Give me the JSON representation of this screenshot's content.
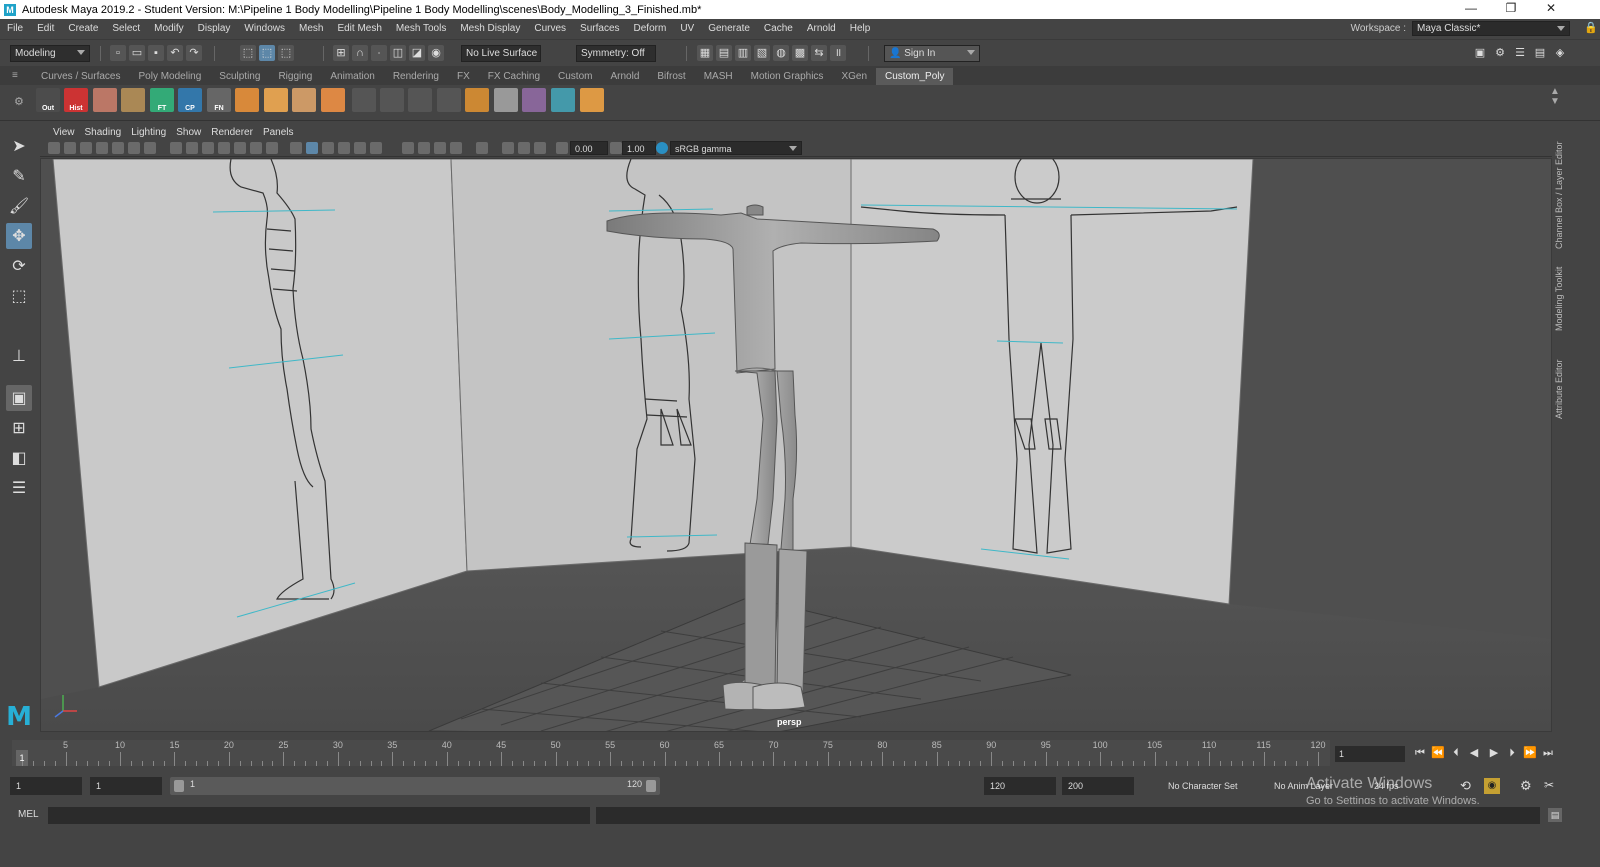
{
  "window": {
    "title": "Autodesk Maya 2019.2 - Student Version: M:\\Pipeline 1 Body Modelling\\Pipeline 1 Body Modelling\\scenes\\Body_Modelling_3_Finished.mb*",
    "app_icon_letter": "M",
    "minimize_glyph": "—",
    "restore_glyph": "❐",
    "close_glyph": "✕"
  },
  "menubar": {
    "items": [
      "File",
      "Edit",
      "Create",
      "Select",
      "Modify",
      "Display",
      "Windows",
      "Mesh",
      "Edit Mesh",
      "Mesh Tools",
      "Mesh Display",
      "Curves",
      "Surfaces",
      "Deform",
      "UV",
      "Generate",
      "Cache",
      "Arnold",
      "Help"
    ],
    "workspace_label": "Workspace :",
    "workspace_value": "Maya Classic*",
    "lock_glyph": "🔒"
  },
  "statusline": {
    "menuset": "Modeling",
    "live_surface": "No Live Surface",
    "symmetry": "Symmetry: Off",
    "sign_in": "Sign In"
  },
  "shelf": {
    "tabs": [
      "Curves / Surfaces",
      "Poly Modeling",
      "Sculpting",
      "Rigging",
      "Animation",
      "Rendering",
      "FX",
      "FX Caching",
      "Custom",
      "Arnold",
      "Bifrost",
      "MASH",
      "Motion Graphics",
      "XGen",
      "Custom_Poly"
    ],
    "active_tab": "Custom_Poly",
    "icon_labels": [
      "Out",
      "Hist",
      "FT",
      "CP",
      "FN"
    ]
  },
  "panel": {
    "menus": [
      "View",
      "Shading",
      "Lighting",
      "Show",
      "Renderer",
      "Panels"
    ],
    "exposure": "0.00",
    "gamma": "1.00",
    "color_space": "sRGB gamma",
    "camera_label": "persp"
  },
  "right_tabs": [
    "Channel Box / Layer Editor",
    "Modeling Toolkit",
    "Attribute Editor"
  ],
  "timeline": {
    "ticks": [
      5,
      10,
      15,
      20,
      25,
      30,
      35,
      40,
      45,
      50,
      55,
      60,
      65,
      70,
      75,
      80,
      85,
      90,
      95,
      100,
      105,
      110,
      115,
      120
    ],
    "current_frame": "1",
    "frame_field": "1",
    "start": 1,
    "end": 120
  },
  "range": {
    "start_field": "1",
    "playback_start_field": "1",
    "slider_start": "1",
    "slider_end": "120",
    "playback_end_field": "120",
    "end_field": "200",
    "character_set": "No Character Set",
    "anim_layer": "No Anim Layer",
    "fps": "24 fps"
  },
  "watermark": {
    "line1": "Activate Windows",
    "line2": "Go to Settings to activate Windows."
  },
  "cmdline": {
    "label": "MEL",
    "value": ""
  },
  "colors": {
    "accent": "#5d87a8",
    "viewport_bg": "#4f4f4f",
    "maya_logo": "#27b0d6"
  }
}
